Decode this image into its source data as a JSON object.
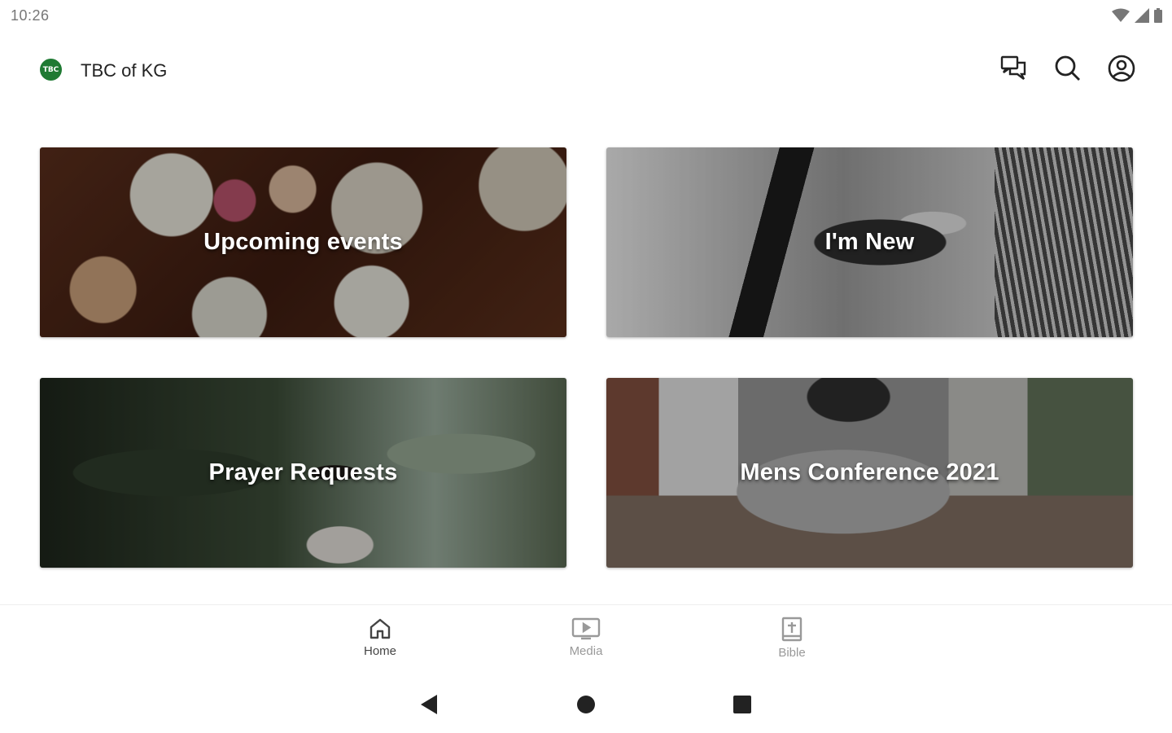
{
  "status_bar": {
    "time": "10:26",
    "icons": [
      "wifi-icon",
      "signal-icon",
      "battery-icon"
    ]
  },
  "app_bar": {
    "logo_text": "TBC",
    "title": "TBC of KG",
    "actions": [
      "chat-icon",
      "search-icon",
      "account-icon"
    ]
  },
  "tiles": [
    {
      "label": "Upcoming events"
    },
    {
      "label": "I'm New"
    },
    {
      "label": "Prayer Requests"
    },
    {
      "label": "Mens Conference 2021"
    }
  ],
  "bottom_nav": {
    "items": [
      {
        "label": "Home",
        "icon": "home-icon",
        "selected": true
      },
      {
        "label": "Media",
        "icon": "media-icon",
        "selected": false
      },
      {
        "label": "Bible",
        "icon": "bible-icon",
        "selected": false
      }
    ]
  },
  "system_nav": [
    "back-icon",
    "home-circle-icon",
    "recents-icon"
  ],
  "colors": {
    "brand": "#1f7a33",
    "nav_selected": "#444444",
    "nav_unselected": "#999999"
  }
}
